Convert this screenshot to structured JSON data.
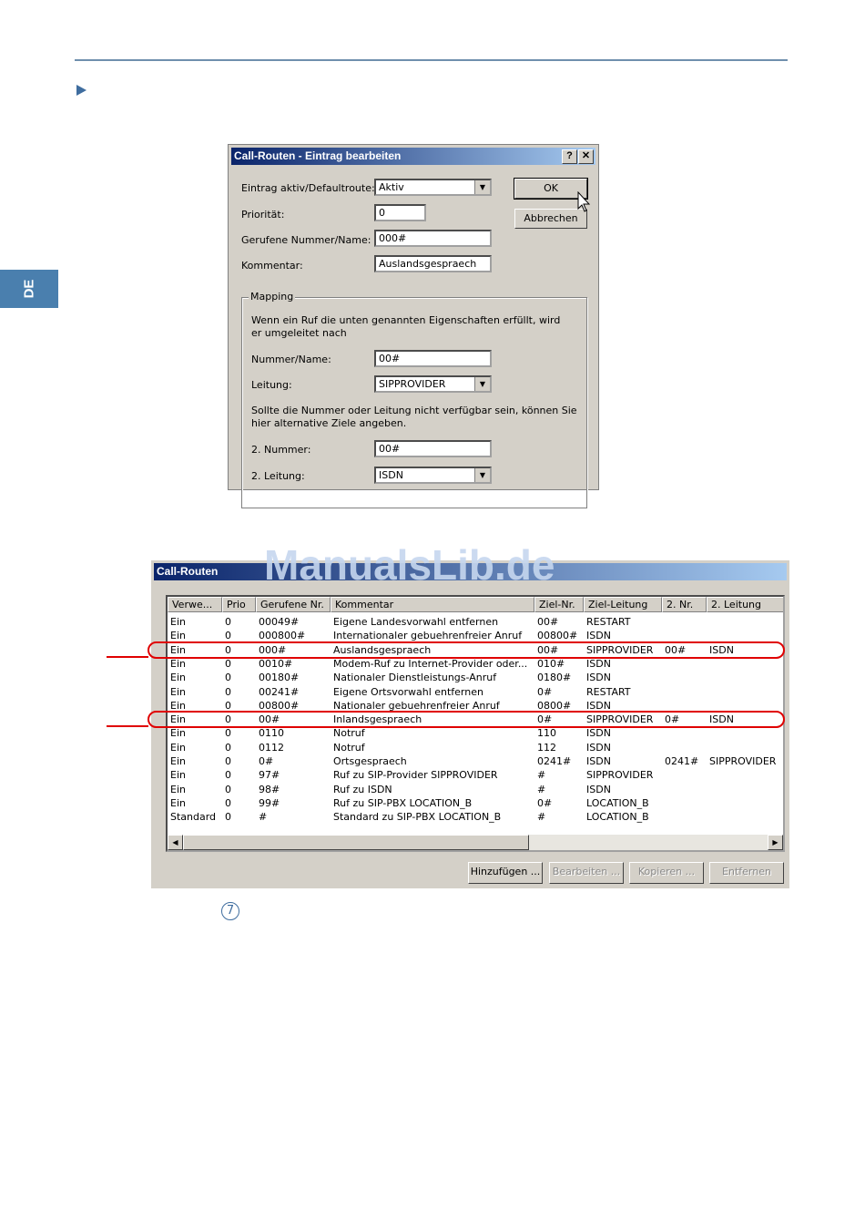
{
  "side_tab": "DE",
  "dialog": {
    "title": "Call-Routen - Eintrag bearbeiten",
    "help_btn": "?",
    "close_btn": "✕",
    "ok": "OK",
    "cancel": "Abbrechen",
    "fields": {
      "active_label": "Eintrag aktiv/Defaultroute:",
      "active_value": "Aktiv",
      "prio_label": "Priorität:",
      "prio_value": "0",
      "number_label": "Gerufene Nummer/Name:",
      "number_value": "000#",
      "comment_label": "Kommentar:",
      "comment_value": "Auslandsgespraech"
    },
    "mapping": {
      "legend": "Mapping",
      "desc": "Wenn ein Ruf die unten genannten Eigenschaften erfüllt, wird er umgeleitet nach",
      "num_label": "Nummer/Name:",
      "num_value": "00#",
      "line_label": "Leitung:",
      "line_value": "SIPPROVIDER",
      "alt_desc": "Sollte die Nummer oder Leitung nicht verfügbar sein, können Sie hier alternative Ziele angeben.",
      "num2_label": "2. Nummer:",
      "num2_value": "00#",
      "line2_label": "2. Leitung:",
      "line2_value": "ISDN"
    }
  },
  "routes": {
    "title": "Call-Routen",
    "headers": [
      "Verwe...",
      "Prio",
      "Gerufene Nr.",
      "Kommentar",
      "Ziel-Nr.",
      "Ziel-Leitung",
      "2. Nr.",
      "2. Leitung"
    ],
    "rows": [
      [
        "Ein",
        "0",
        "00049#",
        "Eigene Landesvorwahl entfernen",
        "00#",
        "RESTART",
        "",
        ""
      ],
      [
        "Ein",
        "0",
        "000800#",
        "Internationaler gebuehrenfreier Anruf",
        "00800#",
        "ISDN",
        "",
        ""
      ],
      [
        "Ein",
        "0",
        "000#",
        "Auslandsgespraech",
        "00#",
        "SIPPROVIDER",
        "00#",
        "ISDN"
      ],
      [
        "Ein",
        "0",
        "0010#",
        "Modem-Ruf zu Internet-Provider oder...",
        "010#",
        "ISDN",
        "",
        ""
      ],
      [
        "Ein",
        "0",
        "00180#",
        "Nationaler Dienstleistungs-Anruf",
        "0180#",
        "ISDN",
        "",
        ""
      ],
      [
        "Ein",
        "0",
        "00241#",
        "Eigene Ortsvorwahl entfernen",
        "0#",
        "RESTART",
        "",
        ""
      ],
      [
        "Ein",
        "0",
        "00800#",
        "Nationaler gebuehrenfreier Anruf",
        "0800#",
        "ISDN",
        "",
        ""
      ],
      [
        "Ein",
        "0",
        "00#",
        "Inlandsgespraech",
        "0#",
        "SIPPROVIDER",
        "0#",
        "ISDN"
      ],
      [
        "Ein",
        "0",
        "0110",
        "Notruf",
        "110",
        "ISDN",
        "",
        ""
      ],
      [
        "Ein",
        "0",
        "0112",
        "Notruf",
        "112",
        "ISDN",
        "",
        ""
      ],
      [
        "Ein",
        "0",
        "0#",
        "Ortsgespraech",
        "0241#",
        "ISDN",
        "0241#",
        "SIPPROVIDER"
      ],
      [
        "Ein",
        "0",
        "97#",
        "Ruf zu SIP-Provider SIPPROVIDER",
        "#",
        "SIPPROVIDER",
        "",
        ""
      ],
      [
        "Ein",
        "0",
        "98#",
        "Ruf zu ISDN",
        "#",
        "ISDN",
        "",
        ""
      ],
      [
        "Ein",
        "0",
        "99#",
        "Ruf zu SIP-PBX LOCATION_B",
        "0#",
        "LOCATION_B",
        "",
        ""
      ],
      [
        "Standard",
        "0",
        "#",
        "Standard zu SIP-PBX LOCATION_B",
        "#",
        "LOCATION_B",
        "",
        ""
      ]
    ],
    "buttons": {
      "add": "Hinzufügen ...",
      "edit": "Bearbeiten ...",
      "copy": "Kopieren ...",
      "remove": "Entfernen"
    }
  },
  "watermark": "ManualsLib.de",
  "step_marker": "7",
  "colors": {
    "accent": "#3f6d9f",
    "highlight": "#e00000",
    "titlebar": "#0a246a",
    "face": "#d4d0c8"
  }
}
